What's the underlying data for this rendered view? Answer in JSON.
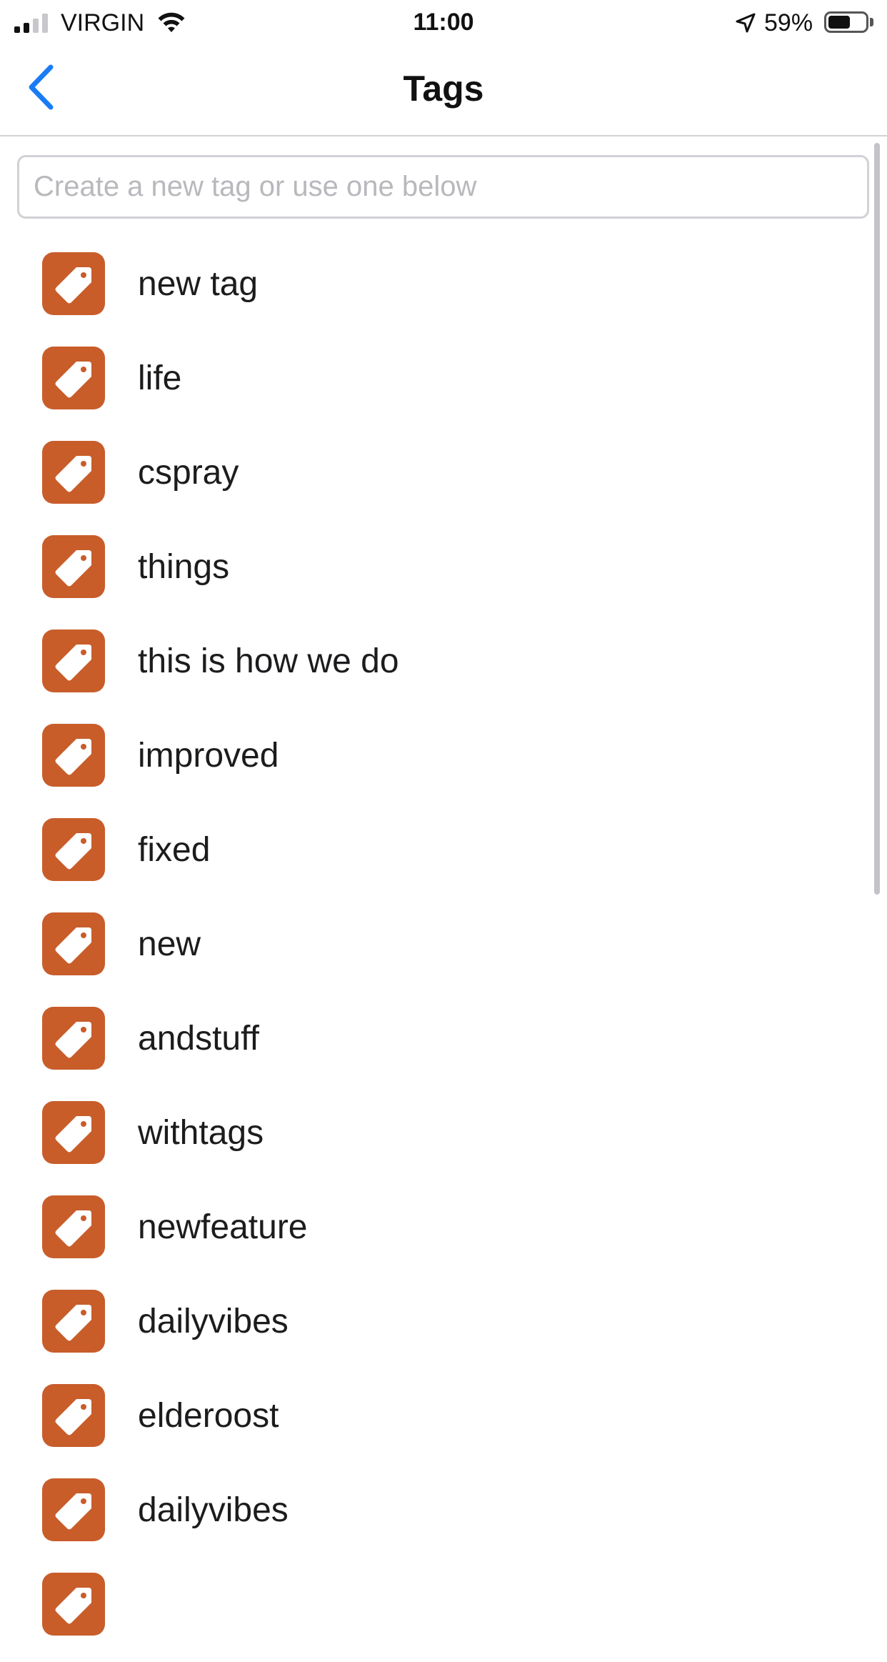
{
  "status_bar": {
    "carrier": "VIRGIN",
    "time": "11:00",
    "battery_percent": "59%",
    "signal_bars_on": 2,
    "battery_level": 0.59
  },
  "nav": {
    "title": "Tags",
    "back_icon": "chevron-left-icon"
  },
  "search": {
    "placeholder": "Create a new tag or use one below",
    "value": ""
  },
  "tags": [
    {
      "label": "new tag"
    },
    {
      "label": "life"
    },
    {
      "label": "cspray"
    },
    {
      "label": "things"
    },
    {
      "label": "this is how we do"
    },
    {
      "label": "improved"
    },
    {
      "label": "fixed"
    },
    {
      "label": "new"
    },
    {
      "label": "andstuff"
    },
    {
      "label": "withtags"
    },
    {
      "label": "newfeature"
    },
    {
      "label": "dailyvibes"
    },
    {
      "label": "elderoost"
    },
    {
      "label": "dailyvibes"
    },
    {
      "label": ""
    }
  ],
  "colors": {
    "accent": "#1a7cf5",
    "tag_icon_bg": "#c85d2a"
  }
}
